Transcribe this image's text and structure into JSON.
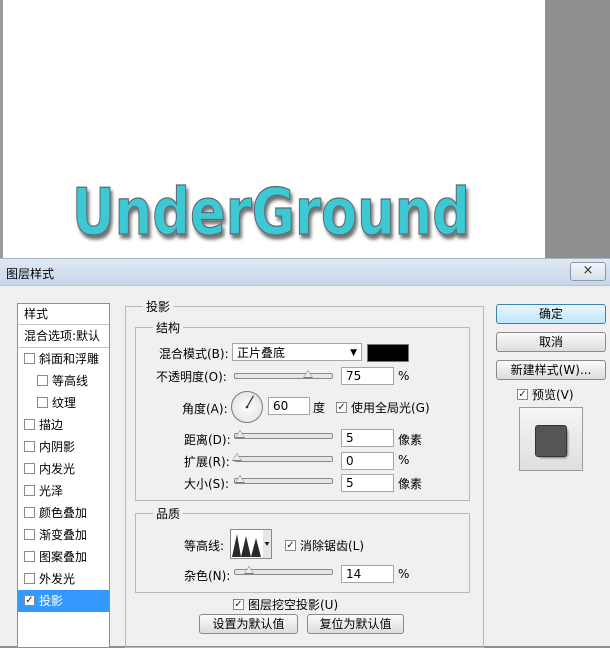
{
  "canvas": {
    "text": "UnderGround",
    "text_color": "#3ec9d4"
  },
  "dialog": {
    "title": "图层样式",
    "close_icon": "×",
    "styles_header": "样式",
    "blend_options": "混合选项:默认",
    "style_items": [
      {
        "label": "斜面和浮雕",
        "checked": false,
        "indent": false
      },
      {
        "label": "等高线",
        "checked": false,
        "indent": true
      },
      {
        "label": "纹理",
        "checked": false,
        "indent": true
      },
      {
        "label": "描边",
        "checked": false,
        "indent": false
      },
      {
        "label": "内阴影",
        "checked": false,
        "indent": false
      },
      {
        "label": "内发光",
        "checked": false,
        "indent": false
      },
      {
        "label": "光泽",
        "checked": false,
        "indent": false
      },
      {
        "label": "颜色叠加",
        "checked": false,
        "indent": false
      },
      {
        "label": "渐变叠加",
        "checked": false,
        "indent": false
      },
      {
        "label": "图案叠加",
        "checked": false,
        "indent": false
      },
      {
        "label": "外发光",
        "checked": false,
        "indent": false
      },
      {
        "label": "投影",
        "checked": true,
        "indent": false,
        "selected": true
      }
    ],
    "panel_title": "投影",
    "structure": {
      "title": "结构",
      "blend_mode_label": "混合模式(B):",
      "blend_mode_value": "正片叠底",
      "shadow_color": "#000000",
      "opacity_label": "不透明度(O):",
      "opacity_value": "75",
      "opacity_unit": "%",
      "opacity_level": 75,
      "angle_label": "角度(A):",
      "angle_value": "60",
      "angle_unit": "度",
      "global_light_label": "使用全局光(G)",
      "global_light_checked": true,
      "distance_label": "距离(D):",
      "distance_value": "5",
      "distance_unit": "像素",
      "spread_label": "扩展(R):",
      "spread_value": "0",
      "spread_unit": "%",
      "size_label": "大小(S):",
      "size_value": "5",
      "size_unit": "像素"
    },
    "quality": {
      "title": "品质",
      "contour_label": "等高线:",
      "anti_alias_label": "消除锯齿(L)",
      "anti_alias_checked": true,
      "noise_label": "杂色(N):",
      "noise_value": "14",
      "noise_unit": "%"
    },
    "knockout_label": "图层挖空投影(U)",
    "knockout_checked": true,
    "make_default": "设置为默认值",
    "reset_default": "复位为默认值",
    "ok": "确定",
    "cancel": "取消",
    "new_style": "新建样式(W)...",
    "preview_label": "预览(V)",
    "preview_checked": true
  }
}
